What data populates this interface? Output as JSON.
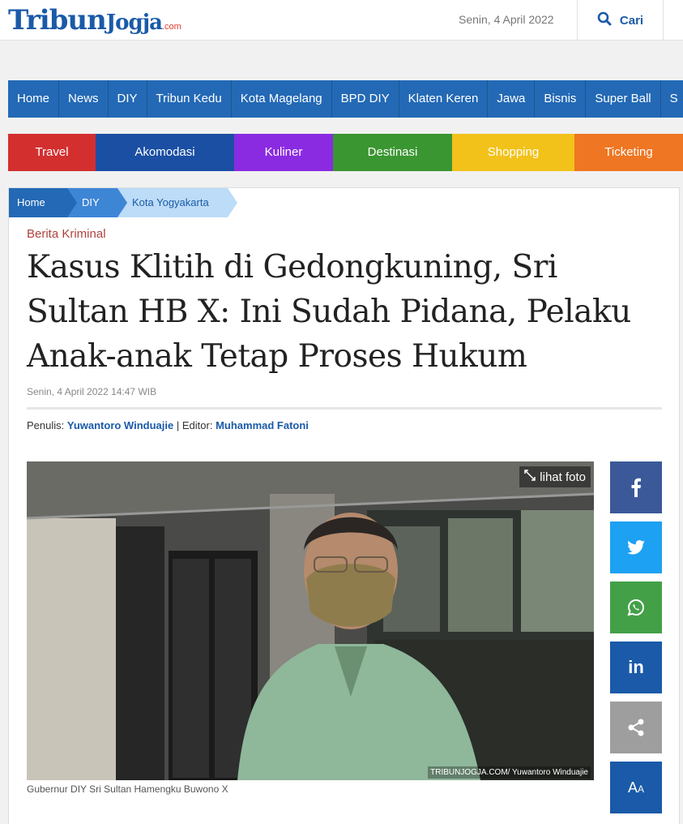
{
  "header": {
    "logo_main": "Tribun",
    "logo_second": "Jogja",
    "logo_suffix": ".com",
    "date": "Senin, 4 April 2022",
    "search_label": "Cari"
  },
  "nav": {
    "items": [
      "Home",
      "News",
      "DIY",
      "Tribun Kedu",
      "Kota Magelang",
      "BPD DIY",
      "Klaten Keren",
      "Jawa",
      "Bisnis",
      "Super Ball",
      "S"
    ]
  },
  "categories": [
    {
      "label": "Travel",
      "color": "#d32f2f"
    },
    {
      "label": "Akomodasi",
      "color": "#1b4fa3"
    },
    {
      "label": "Kuliner",
      "color": "#8a2be2"
    },
    {
      "label": "Destinasi",
      "color": "#3a9630"
    },
    {
      "label": "Shopping",
      "color": "#f2c21b"
    },
    {
      "label": "Ticketing",
      "color": "#ef7622"
    }
  ],
  "breadcrumb": [
    {
      "label": "Home",
      "color": "#2369b5"
    },
    {
      "label": "DIY",
      "color": "#3d86d6"
    },
    {
      "label": "Kota Yogyakarta",
      "color": "#bcdcf7"
    }
  ],
  "article": {
    "kicker": "Berita Kriminal",
    "title": "Kasus Klitih di Gedongkuning, Sri Sultan HB X: Ini Sudah Pidana, Pelaku Anak-anak Tetap Proses Hukum",
    "published": "Senin, 4 April 2022 14:47 WIB",
    "writer_label": "Penulis:",
    "writer": "Yuwantoro Winduajie",
    "separator": "|",
    "editor_label": "Editor:",
    "editor": "Muhammad Fatoni",
    "photo_button": "lihat foto",
    "photo_credit": "TRIBUNJOGJA.COM/ Yuwantoro Winduajie",
    "caption": "Gubernur DIY Sri Sultan Hamengku Buwono X"
  },
  "share": [
    {
      "name": "facebook-icon",
      "color": "#3b5998",
      "glyph": "f"
    },
    {
      "name": "twitter-icon",
      "color": "#1da1f2",
      "glyph": "t"
    },
    {
      "name": "whatsapp-icon",
      "color": "#43a047",
      "glyph": "w"
    },
    {
      "name": "linkedin-icon",
      "color": "#1a5aa8",
      "glyph": "in"
    },
    {
      "name": "share-icon",
      "color": "#9e9e9e",
      "glyph": "s"
    },
    {
      "name": "font-size-icon",
      "color": "#1a5aa8",
      "glyph": "A"
    }
  ]
}
